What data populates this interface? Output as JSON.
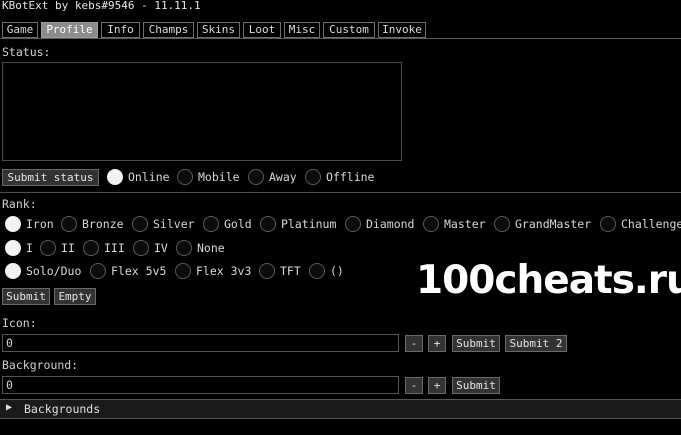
{
  "window": {
    "title": "KBotExt by kebs#9546 - 11.11.1"
  },
  "tabs": [
    "Game",
    "Profile",
    "Info",
    "Champs",
    "Skins",
    "Loot",
    "Misc",
    "Custom",
    "Invoke"
  ],
  "status": {
    "label": "Status:",
    "value": "",
    "submit_label": "Submit status",
    "options": [
      "Online",
      "Mobile",
      "Away",
      "Offline"
    ],
    "selected": "Online"
  },
  "rank": {
    "label": "Rank:",
    "tiers": [
      "Iron",
      "Bronze",
      "Silver",
      "Gold",
      "Platinum",
      "Diamond",
      "Master",
      "GrandMaster",
      "Challenger"
    ],
    "selected_tier": "Iron",
    "divisions": [
      "I",
      "II",
      "III",
      "IV",
      "None"
    ],
    "selected_division": "I",
    "queues": [
      "Solo/Duo",
      "Flex 5v5",
      "Flex 3v3",
      "TFT",
      "()"
    ],
    "selected_queue": "Solo/Duo",
    "submit_label": "Submit",
    "empty_label": "Empty"
  },
  "icon": {
    "label": "Icon:",
    "value": "0",
    "minus": "-",
    "plus": "+",
    "submit_label": "Submit",
    "submit2_label": "Submit 2"
  },
  "background": {
    "label": "Background:",
    "value": "0",
    "minus": "-",
    "plus": "+",
    "submit_label": "Submit"
  },
  "backgrounds_section": {
    "arrow": "▶",
    "label": "Backgrounds"
  },
  "watermark": "100cheats.ru"
}
